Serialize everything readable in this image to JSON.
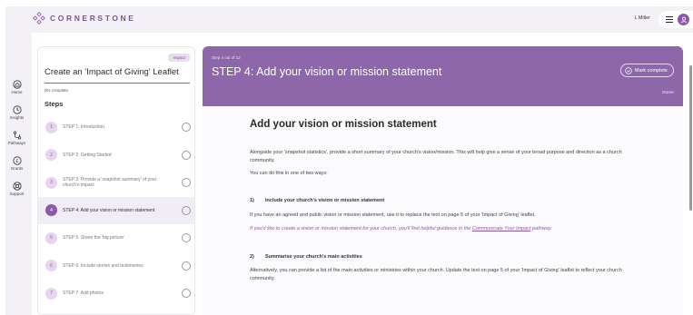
{
  "header": {
    "app_name": "CORNERSTONE",
    "user_name": "L Miller",
    "menu_icon": "hamburger-menu-icon",
    "avatar_icon": "user-avatar-icon",
    "brand_color": "#7b5592"
  },
  "nav": {
    "items": [
      {
        "label": "Home",
        "icon": "home-icon"
      },
      {
        "label": "Insights",
        "icon": "clock-icon"
      },
      {
        "label": "Pathways",
        "icon": "pathways-icon"
      },
      {
        "label": "Grants",
        "icon": "pound-coin-icon"
      },
      {
        "label": "Support",
        "icon": "lifebuoy-icon"
      }
    ]
  },
  "course": {
    "badge": "Impact",
    "title": "Create an 'Impact of Giving' Leaflet",
    "progress": "0% complete",
    "progress_value": 0,
    "steps_heading": "Steps",
    "steps": [
      {
        "num": "1",
        "label": "STEP 1: Introduction"
      },
      {
        "num": "2",
        "label": "STEP 2: Getting Started"
      },
      {
        "num": "3",
        "label": "STEP 3: Provide a 'snapshot summary' of your church's impact"
      },
      {
        "num": "4",
        "label": "STEP 4: Add your vision or mission statement",
        "active": true
      },
      {
        "num": "5",
        "label": "STEP 5: Share the 'big picture'"
      },
      {
        "num": "6",
        "label": "STEP 6: Include stories and testimonies"
      },
      {
        "num": "7",
        "label": "STEP 7: Add photos"
      }
    ]
  },
  "step": {
    "count": "Step 4 out of 12",
    "title": "STEP 4: Add your vision or mission statement",
    "mark_complete": "Mark complete",
    "owner": "Owner",
    "accent_color": "#8e66aa"
  },
  "body": {
    "heading": "Add your vision or mission statement",
    "intro": "Alongside your 'snapshot statistics', provide a short summary of your church's vision/mission. This will help give a sense of your broad purpose and direction as a church community.",
    "ways": "You can do this in one of two ways:",
    "option1": {
      "num": "1)",
      "title": "Include your church's vision or mission statement",
      "text": "If you have an agreed and public vision or mission statement, use it to replace the text on page 5 of your 'Impact of Giving' leaflet.",
      "help_prefix": "If you'd like to create a vision or mission statement for your church, you'll find helpful guidance in the",
      "help_link": "Communicate Your Impact",
      "help_suffix": "pathway."
    },
    "option2": {
      "num": "2)",
      "title": "Summarise your church's main activities",
      "text": "Alternatively, you can provide a list of the main activities or ministries within your church. Update the text on page 5 of your 'Impact of Giving' leaflet to reflect your church community."
    }
  }
}
